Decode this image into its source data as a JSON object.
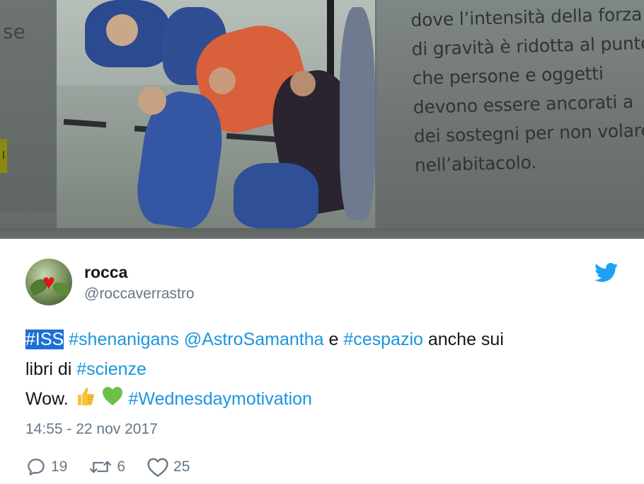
{
  "media": {
    "left_margin_fragment": "se",
    "book_text_lines": [
      "dove l’intensità della forza",
      "di gravità è ridotta al punto",
      "che persone e oggetti",
      "devono essere ancorati a",
      "dei sostegni per non volare",
      "nell’abitacolo."
    ]
  },
  "tweet": {
    "author": {
      "display_name": "rocca",
      "handle": "@roccaverrastro"
    },
    "text": {
      "line1": {
        "tag_iss": "#ISS",
        "tag_shenanigans": "#shenanigans",
        "mention": "@AstroSamantha",
        "word_e": "e",
        "tag_cespazio": "#cespazio",
        "rest": "anche sui"
      },
      "line2": {
        "prefix": "libri di",
        "tag_scienze": "#scienze"
      },
      "line3": {
        "prefix": "Wow.",
        "tag_motivation": "#Wednesdaymotivation"
      }
    },
    "timestamp": "14:55 - 22 nov 2017",
    "actions": {
      "replies": "19",
      "retweets": "6",
      "likes": "25"
    }
  },
  "colors": {
    "link": "#1b95e0",
    "selection": "#1d6fd8",
    "muted": "#657786",
    "twitter_blue": "#1da1f2",
    "emoji_thumb": "#f7c23c",
    "emoji_heart": "#6cc04a"
  },
  "icons": {
    "brand": "twitter-bird-icon",
    "reply": "reply-icon",
    "retweet": "retweet-icon",
    "like": "heart-icon",
    "thumbs_up": "thumbs-up-emoji",
    "green_heart": "green-heart-emoji"
  }
}
